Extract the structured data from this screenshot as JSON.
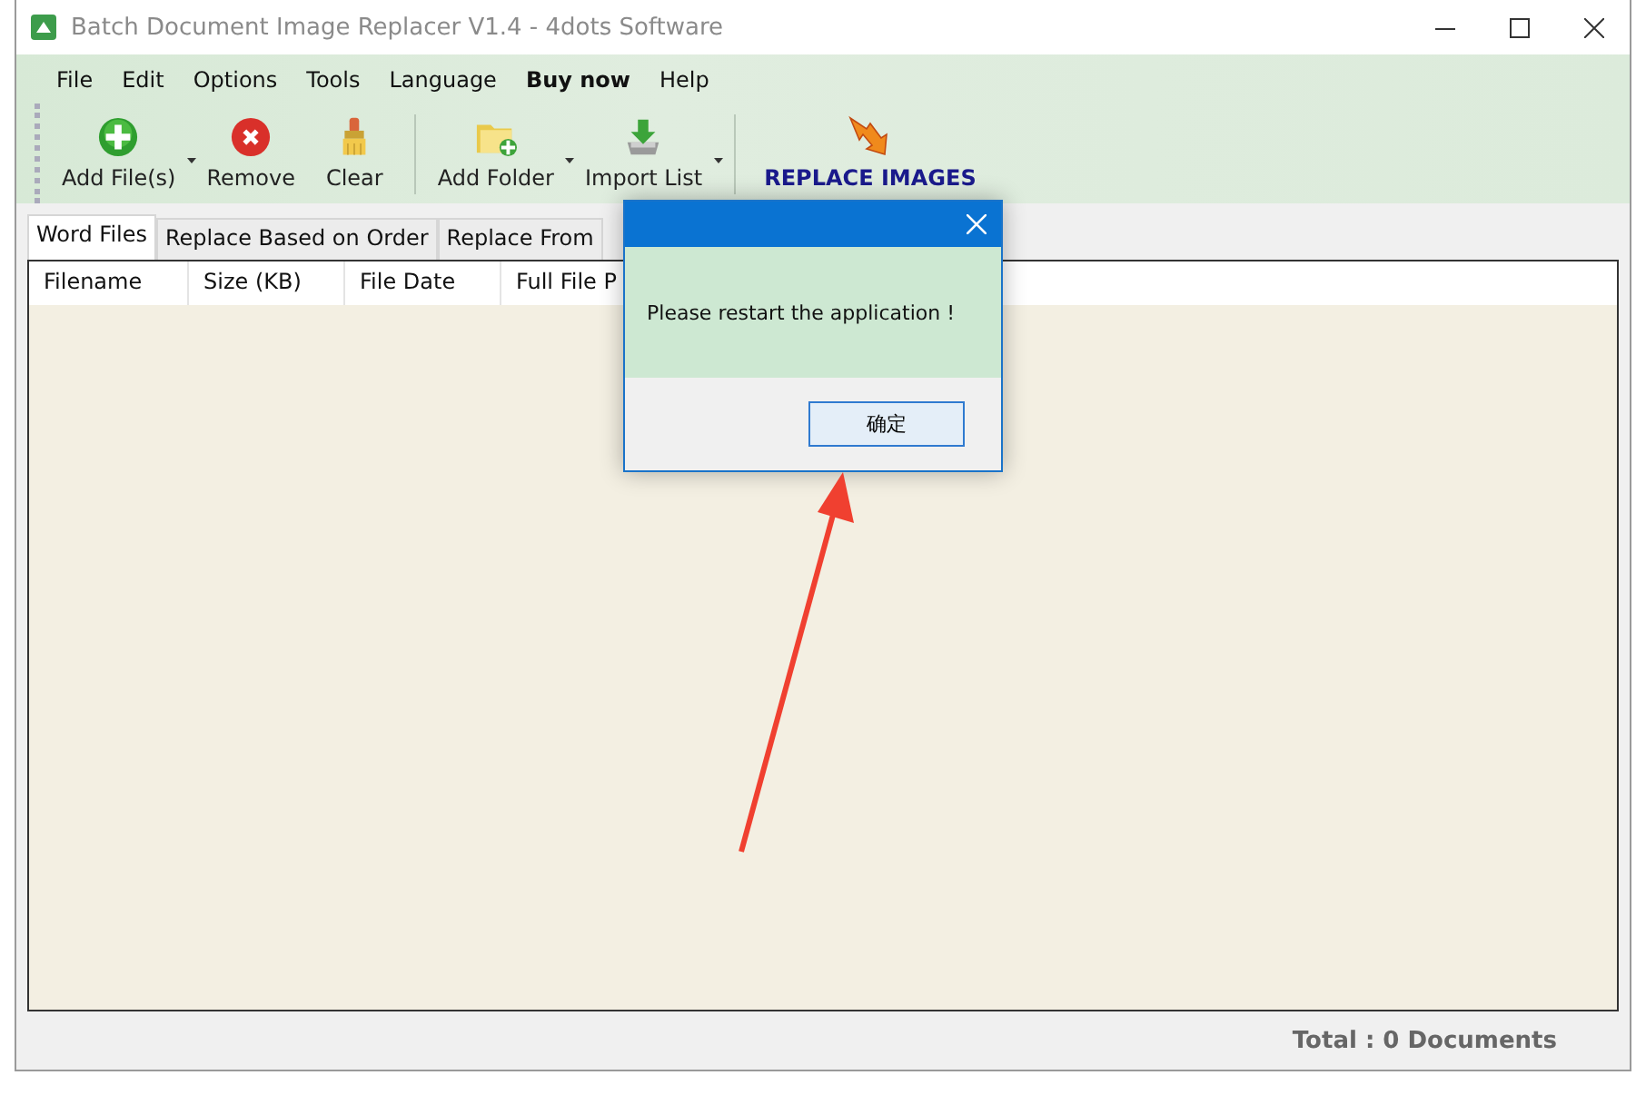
{
  "window": {
    "title": "Batch Document Image Replacer V1.4 - 4dots Software"
  },
  "menu": [
    {
      "label": "File",
      "bold": false
    },
    {
      "label": "Edit",
      "bold": false
    },
    {
      "label": "Options",
      "bold": false
    },
    {
      "label": "Tools",
      "bold": false
    },
    {
      "label": "Language",
      "bold": false
    },
    {
      "label": "Buy now",
      "bold": true
    },
    {
      "label": "Help",
      "bold": false
    }
  ],
  "toolbar": [
    {
      "kind": "button",
      "label": "Add File(s)",
      "dropdown": true
    },
    {
      "kind": "button",
      "label": "Remove",
      "dropdown": false
    },
    {
      "kind": "button",
      "label": "Clear",
      "dropdown": false
    },
    {
      "kind": "separator"
    },
    {
      "kind": "button",
      "label": "Add Folder",
      "dropdown": true
    },
    {
      "kind": "button",
      "label": "Import List",
      "dropdown": true
    },
    {
      "kind": "separator"
    },
    {
      "kind": "primary",
      "label": "REPLACE IMAGES",
      "dropdown": false
    }
  ],
  "tabs": [
    {
      "label": "Word Files",
      "selected": true
    },
    {
      "label": "Replace Based on Order",
      "selected": false
    },
    {
      "label": "Replace From",
      "selected": false
    }
  ],
  "table": {
    "columns": [
      "Filename",
      "Size (KB)",
      "File Date",
      "Full File P"
    ]
  },
  "status_bar": {
    "total": "Total : 0 Documents"
  },
  "dialog": {
    "message": "Please restart the application !",
    "button": "确定"
  }
}
